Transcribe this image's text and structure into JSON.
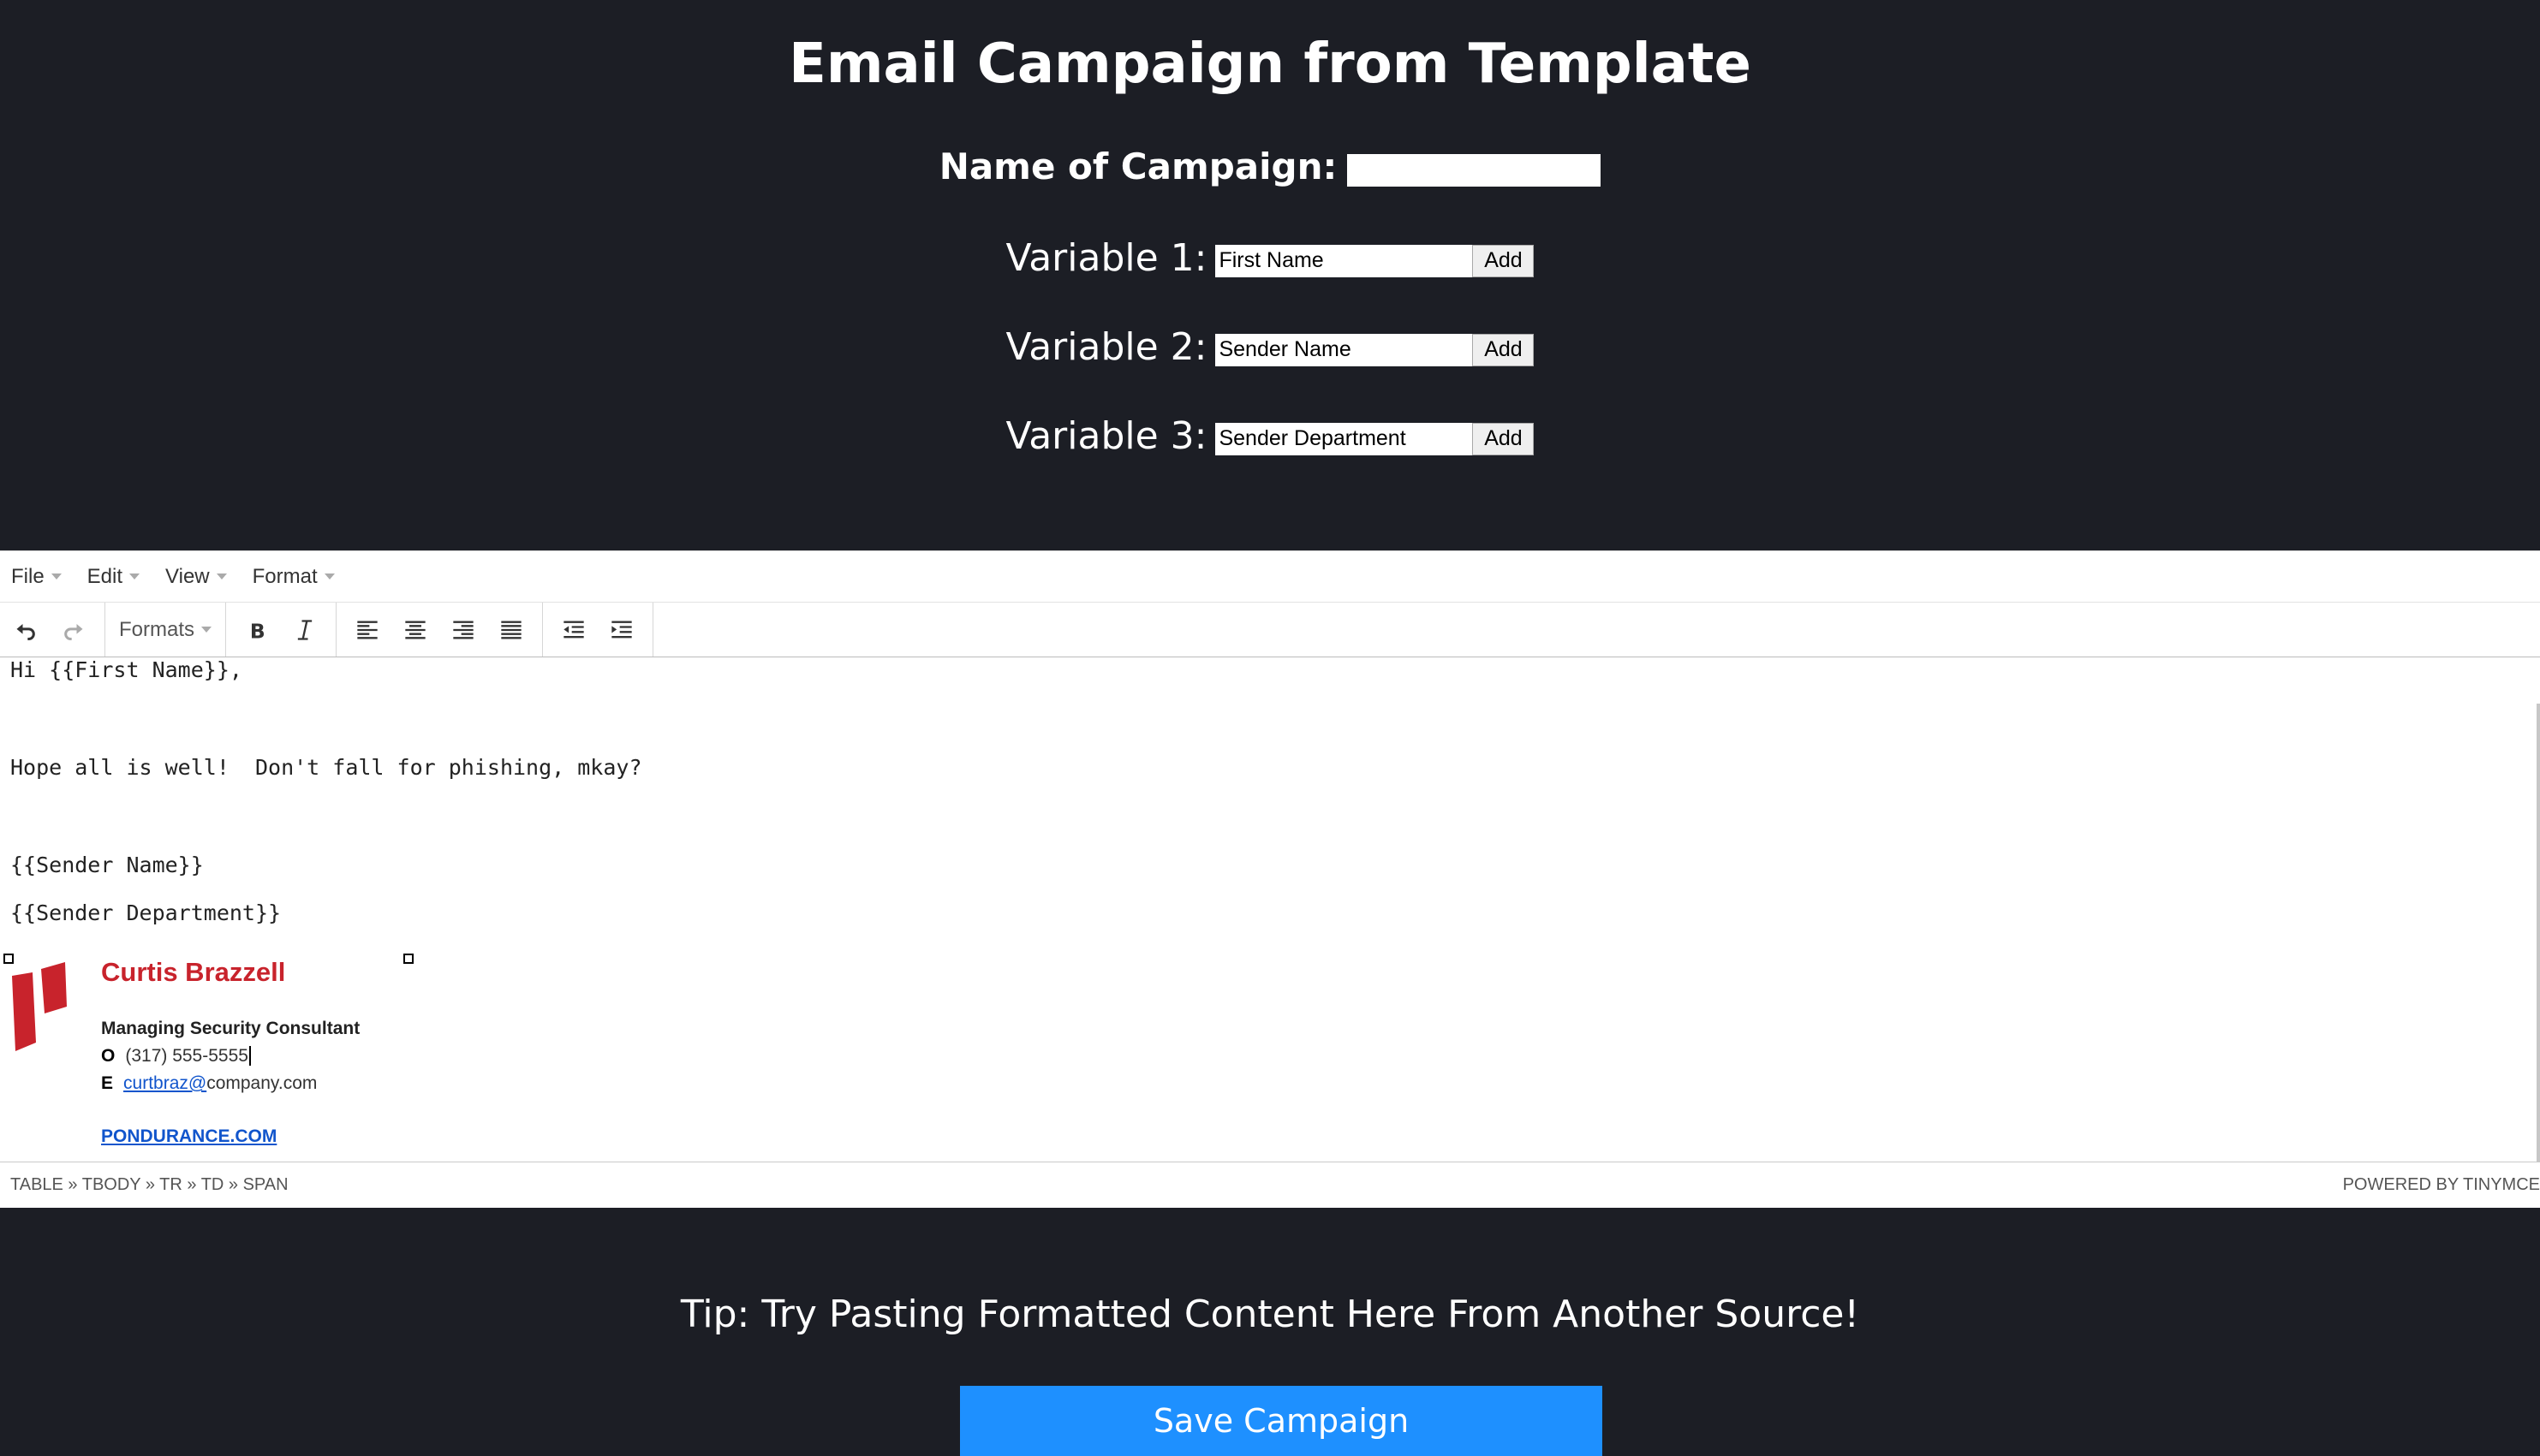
{
  "header": {
    "title": "Email Campaign from Template",
    "campaign_label": "Name of Campaign:",
    "campaign_value": ""
  },
  "variables": [
    {
      "label": "Variable 1:",
      "value": "First Name",
      "button": "Add"
    },
    {
      "label": "Variable 2:",
      "value": "Sender Name",
      "button": "Add"
    },
    {
      "label": "Variable 3:",
      "value": "Sender Department",
      "button": "Add"
    }
  ],
  "editor": {
    "menu": [
      "File",
      "Edit",
      "View",
      "Format"
    ],
    "toolbar": {
      "formats_label": "Formats",
      "icons": [
        "undo-icon",
        "redo-icon",
        "bold-icon",
        "italic-icon",
        "align-left-icon",
        "align-center-icon",
        "align-right-icon",
        "align-justify-icon",
        "outdent-icon",
        "indent-icon"
      ]
    },
    "content": {
      "line1": "Hi {{First Name}},",
      "line2": "Hope all is well!  Don't fall for phishing, mkay?",
      "line3": "{{Sender Name}}",
      "line4": "{{Sender Department}}"
    },
    "signature": {
      "name": "Curtis Brazzell",
      "title": "Managing Security Consultant",
      "office_label": "O",
      "office_phone": "(317) 555-5555",
      "email_label": "E",
      "email_link": "curtbraz@",
      "email_domain": "company.com",
      "website": "PONDURANCE.COM",
      "brand_color": "#c8232c"
    },
    "statusbar": {
      "path": "TABLE » TBODY » TR » TD » SPAN",
      "powered_by": "POWERED BY TINYMCE"
    }
  },
  "footer": {
    "tip": "Tip: Try Pasting Formatted Content Here From Another Source!",
    "save_label": "Save Campaign",
    "save_color": "#1e90ff"
  }
}
